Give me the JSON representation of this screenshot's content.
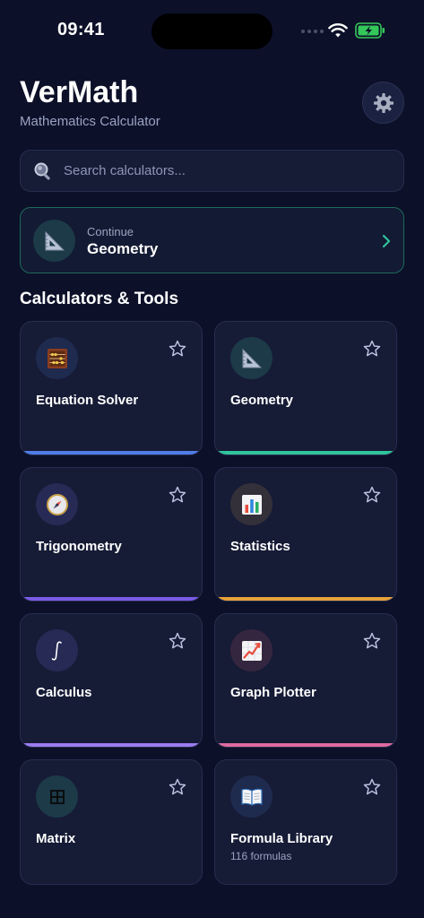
{
  "status": {
    "time": "09:41"
  },
  "header": {
    "title": "VerMath",
    "subtitle": "Mathematics Calculator"
  },
  "search": {
    "placeholder": "Search calculators..."
  },
  "continue": {
    "label": "Continue",
    "value": "Geometry"
  },
  "section": {
    "title": "Calculators & Tools"
  },
  "cards": [
    {
      "title": "Equation Solver",
      "subtitle": "",
      "icon": "abacus-icon",
      "icon_bg": "#1f2a4f",
      "accent": "#4f7de8"
    },
    {
      "title": "Geometry",
      "subtitle": "",
      "icon": "triangle-ruler-icon",
      "icon_bg": "#1c3a48",
      "accent": "#2fc49b"
    },
    {
      "title": "Trigonometry",
      "subtitle": "",
      "icon": "compass-icon",
      "icon_bg": "#262a55",
      "accent": "#7b5ce8"
    },
    {
      "title": "Statistics",
      "subtitle": "",
      "icon": "bar-chart-icon",
      "icon_bg": "#33303a",
      "accent": "#e8a23a"
    },
    {
      "title": "Calculus",
      "subtitle": "",
      "icon": "integral-icon",
      "icon_bg": "#262a55",
      "accent": "#9a7cf0"
    },
    {
      "title": "Graph Plotter",
      "subtitle": "",
      "icon": "line-chart-icon",
      "icon_bg": "#35263f",
      "accent": "#e06aa0"
    },
    {
      "title": "Matrix",
      "subtitle": "",
      "icon": "grid-icon",
      "icon_bg": "#1c3a48",
      "accent": "#2fc49b"
    },
    {
      "title": "Formula Library",
      "subtitle": "116 formulas",
      "icon": "book-icon",
      "icon_bg": "#1f2a4f",
      "accent": "#4f7de8"
    }
  ],
  "colors": {
    "background": "#0c1029",
    "card": "#161b36",
    "continue_border": "#1f6b5c",
    "chevron": "#2fc49b",
    "star": "#b9c2e0"
  }
}
